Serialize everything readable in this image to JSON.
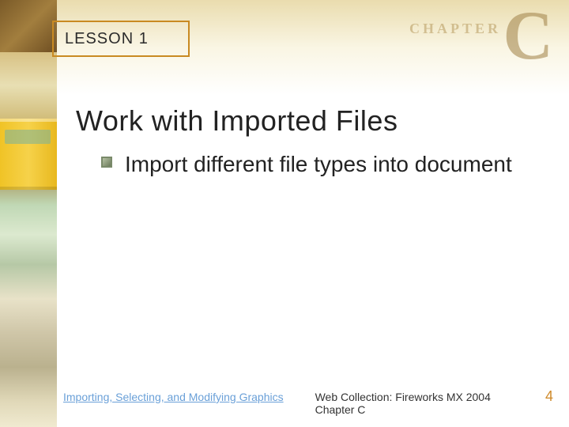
{
  "header": {
    "lesson_label": "LESSON 1",
    "chapter_word": "CHAPTER",
    "chapter_letter": "C"
  },
  "heading": "Work with Imported Files",
  "bullets": [
    "Import different file types into document"
  ],
  "footer": {
    "left_link": "Importing, Selecting, and Modifying Graphics",
    "center": "Web Collection: Fireworks MX 2004 Chapter C",
    "page": "4"
  }
}
